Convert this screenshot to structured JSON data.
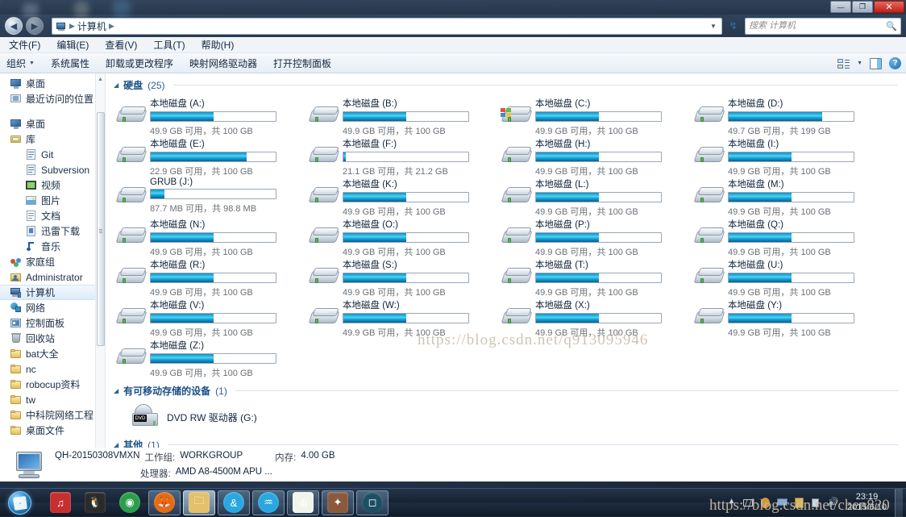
{
  "window": {
    "buttons": {
      "minimize": "—",
      "maximize": "❐",
      "close": "✕"
    }
  },
  "address": {
    "computer_icon": "computer-icon",
    "crumb": "计算机",
    "sep": "▶",
    "dropdown": "▼",
    "refresh": "↯"
  },
  "search": {
    "placeholder": "搜索 计算机",
    "value": "",
    "icon": "search-icon"
  },
  "menubar": {
    "items": [
      "文件(F)",
      "编辑(E)",
      "查看(V)",
      "工具(T)",
      "帮助(H)"
    ]
  },
  "commandbar": {
    "organize": "组织",
    "caret": "▼",
    "items": [
      "系统属性",
      "卸载或更改程序",
      "映射网络驱动器",
      "打开控制面板"
    ],
    "view_caret": "▼",
    "help": "?"
  },
  "sidebar": {
    "favorites": [
      {
        "label": "桌面",
        "icon": "desktop-icon",
        "indent": 1
      },
      {
        "label": "最近访问的位置",
        "icon": "recent-places-icon",
        "indent": 1
      }
    ],
    "tree": [
      {
        "label": "桌面",
        "icon": "desktop-icon",
        "indent": 0,
        "selected": false
      },
      {
        "label": "库",
        "icon": "library-folder-icon",
        "indent": 1,
        "selected": false
      },
      {
        "label": "Git",
        "icon": "library-icon",
        "indent": 2,
        "selected": false
      },
      {
        "label": "Subversion",
        "icon": "library-icon",
        "indent": 2,
        "selected": false
      },
      {
        "label": "视频",
        "icon": "video-library-icon",
        "indent": 2,
        "selected": false
      },
      {
        "label": "图片",
        "icon": "pictures-library-icon",
        "indent": 2,
        "selected": false
      },
      {
        "label": "文档",
        "icon": "documents-library-icon",
        "indent": 2,
        "selected": false
      },
      {
        "label": "迅雷下载",
        "icon": "download-library-icon",
        "indent": 2,
        "selected": false
      },
      {
        "label": "音乐",
        "icon": "music-library-icon",
        "indent": 2,
        "selected": false
      },
      {
        "label": "家庭组",
        "icon": "homegroup-icon",
        "indent": 1,
        "selected": false
      },
      {
        "label": "Administrator",
        "icon": "user-folder-icon",
        "indent": 1,
        "selected": false
      },
      {
        "label": "计算机",
        "icon": "computer-icon",
        "indent": 1,
        "selected": true
      },
      {
        "label": "网络",
        "icon": "network-icon",
        "indent": 1,
        "selected": false
      },
      {
        "label": "控制面板",
        "icon": "control-panel-icon",
        "indent": 1,
        "selected": false
      },
      {
        "label": "回收站",
        "icon": "recycle-bin-icon",
        "indent": 1,
        "selected": false
      },
      {
        "label": "bat大全",
        "icon": "folder-icon",
        "indent": 1,
        "selected": false
      },
      {
        "label": "nc",
        "icon": "folder-icon",
        "indent": 1,
        "selected": false
      },
      {
        "label": "robocup资料",
        "icon": "folder-icon",
        "indent": 1,
        "selected": false
      },
      {
        "label": "tw",
        "icon": "folder-icon",
        "indent": 1,
        "selected": false
      },
      {
        "label": "中科院网络工程",
        "icon": "folder-icon",
        "indent": 1,
        "selected": false
      },
      {
        "label": "桌面文件",
        "icon": "folder-icon",
        "indent": 1,
        "selected": false
      }
    ],
    "scroll_up": "▲",
    "scroll_down": "▼"
  },
  "groups": {
    "hard_disks": {
      "title": "硬盘",
      "count": "(25)",
      "triangle": "◢"
    },
    "removable": {
      "title": "有可移动存储的设备",
      "count": "(1)",
      "triangle": "◢"
    },
    "other": {
      "title": "其他",
      "count": "(1)",
      "triangle": "◢"
    }
  },
  "drives": [
    {
      "name": "本地磁盘 (A:)",
      "sub": "49.9 GB 可用，共 100 GB",
      "fill": 50,
      "icon": "hard-drive-icon"
    },
    {
      "name": "本地磁盘 (B:)",
      "sub": "49.9 GB 可用，共 100 GB",
      "fill": 50,
      "icon": "hard-drive-icon"
    },
    {
      "name": "本地磁盘 (C:)",
      "sub": "49.9 GB 可用，共 100 GB",
      "fill": 50,
      "icon": "system-drive-icon"
    },
    {
      "name": "本地磁盘 (D:)",
      "sub": "49.7 GB 可用，共 199 GB",
      "fill": 75,
      "icon": "hard-drive-icon"
    },
    {
      "name": "本地磁盘 (E:)",
      "sub": "22.9 GB 可用，共 100 GB",
      "fill": 77,
      "icon": "hard-drive-icon"
    },
    {
      "name": "本地磁盘 (F:)",
      "sub": "21.1 GB 可用，共 21.2 GB",
      "fill": 2,
      "icon": "hard-drive-icon"
    },
    {
      "name": "本地磁盘 (H:)",
      "sub": "49.9 GB 可用，共 100 GB",
      "fill": 50,
      "icon": "hard-drive-icon"
    },
    {
      "name": "本地磁盘 (I:)",
      "sub": "49.9 GB 可用，共 100 GB",
      "fill": 50,
      "icon": "hard-drive-icon"
    },
    {
      "name": "GRUB (J:)",
      "sub": "87.7 MB 可用，共 98.8 MB",
      "fill": 11,
      "icon": "hard-drive-icon"
    },
    {
      "name": "本地磁盘 (K:)",
      "sub": "49.9 GB 可用，共 100 GB",
      "fill": 50,
      "icon": "hard-drive-icon"
    },
    {
      "name": "本地磁盘 (L:)",
      "sub": "49.9 GB 可用，共 100 GB",
      "fill": 50,
      "icon": "hard-drive-icon"
    },
    {
      "name": "本地磁盘 (M:)",
      "sub": "49.9 GB 可用，共 100 GB",
      "fill": 50,
      "icon": "hard-drive-icon"
    },
    {
      "name": "本地磁盘 (N:)",
      "sub": "49.9 GB 可用，共 100 GB",
      "fill": 50,
      "icon": "hard-drive-icon"
    },
    {
      "name": "本地磁盘 (O:)",
      "sub": "49.9 GB 可用，共 100 GB",
      "fill": 50,
      "icon": "hard-drive-icon"
    },
    {
      "name": "本地磁盘 (P:)",
      "sub": "49.9 GB 可用，共 100 GB",
      "fill": 50,
      "icon": "hard-drive-icon"
    },
    {
      "name": "本地磁盘 (Q:)",
      "sub": "49.9 GB 可用，共 100 GB",
      "fill": 50,
      "icon": "hard-drive-icon"
    },
    {
      "name": "本地磁盘 (R:)",
      "sub": "49.9 GB 可用，共 100 GB",
      "fill": 50,
      "icon": "hard-drive-icon"
    },
    {
      "name": "本地磁盘 (S:)",
      "sub": "49.9 GB 可用，共 100 GB",
      "fill": 50,
      "icon": "hard-drive-icon"
    },
    {
      "name": "本地磁盘 (T:)",
      "sub": "49.9 GB 可用，共 100 GB",
      "fill": 50,
      "icon": "hard-drive-icon"
    },
    {
      "name": "本地磁盘 (U:)",
      "sub": "49.9 GB 可用，共 100 GB",
      "fill": 50,
      "icon": "hard-drive-icon"
    },
    {
      "name": "本地磁盘 (V:)",
      "sub": "49.9 GB 可用，共 100 GB",
      "fill": 50,
      "icon": "hard-drive-icon"
    },
    {
      "name": "本地磁盘 (W:)",
      "sub": "49.9 GB 可用，共 100 GB",
      "fill": 50,
      "icon": "hard-drive-icon"
    },
    {
      "name": "本地磁盘 (X:)",
      "sub": "49.9 GB 可用，共 100 GB",
      "fill": 50,
      "icon": "hard-drive-icon"
    },
    {
      "name": "本地磁盘 (Y:)",
      "sub": "49.9 GB 可用，共 100 GB",
      "fill": 50,
      "icon": "hard-drive-icon"
    },
    {
      "name": "本地磁盘 (Z:)",
      "sub": "49.9 GB 可用，共 100 GB",
      "fill": 50,
      "icon": "hard-drive-icon"
    }
  ],
  "removable_device": {
    "name": "DVD RW 驱动器 (G:)",
    "icon": "dvd-drive-icon",
    "badge": "DVD"
  },
  "computer_info": {
    "name": "QH-20150308VMXN",
    "workgroup_label": "工作组:",
    "workgroup_value": "WORKGROUP",
    "memory_label": "内存:",
    "memory_value": "4.00 GB",
    "cpu_label": "处理器:",
    "cpu_value": "AMD A8-4500M APU ..."
  },
  "watermark": {
    "center": "https://blog.csdn.net/q913095946",
    "taskbar": "https://blog.csdn.net/chen820"
  },
  "taskbar": {
    "start": "start-orb",
    "items": [
      {
        "name": "netease-music",
        "color": "#c62f2f",
        "glyph": "♫",
        "state": "pinned"
      },
      {
        "name": "qq",
        "color": "#2b2b2b",
        "glyph": "🐧",
        "state": "pinned"
      },
      {
        "name": "chrome",
        "color": "#2a9e4b",
        "glyph": "◉",
        "state": "pinned"
      },
      {
        "name": "firefox",
        "color": "#e46a13",
        "glyph": "🦊",
        "state": "open"
      },
      {
        "name": "windows-explorer",
        "color": "#e4c06a",
        "glyph": "🗀",
        "state": "active"
      },
      {
        "name": "360-browser",
        "color": "#2aa7e0",
        "glyph": "&",
        "state": "open"
      },
      {
        "name": "wechat-app",
        "color": "#2aa7e0",
        "glyph": "♒",
        "state": "open"
      },
      {
        "name": "editor-app",
        "color": "#f2f4ec",
        "glyph": "ılı",
        "state": "open"
      },
      {
        "name": "game-app",
        "color": "#8b5a3c",
        "glyph": "✦",
        "state": "open"
      },
      {
        "name": "vmware",
        "color": "#1d4f63",
        "glyph": "◻",
        "state": "open"
      }
    ],
    "tray": [
      "tray-arrow-icon",
      "network-icon",
      "qq-tray-icon",
      "monitor-icon",
      "antivirus-icon",
      "copy-icon",
      "volume-icon"
    ],
    "clock_time": "23:19",
    "clock_date": "2015/6/10"
  },
  "colors": {
    "accent": "#17a8da",
    "bar_light": "#4fd4f2",
    "bar_dark": "#0a5f94",
    "group_title": "#1b4f86",
    "close_red": "#c02016"
  }
}
